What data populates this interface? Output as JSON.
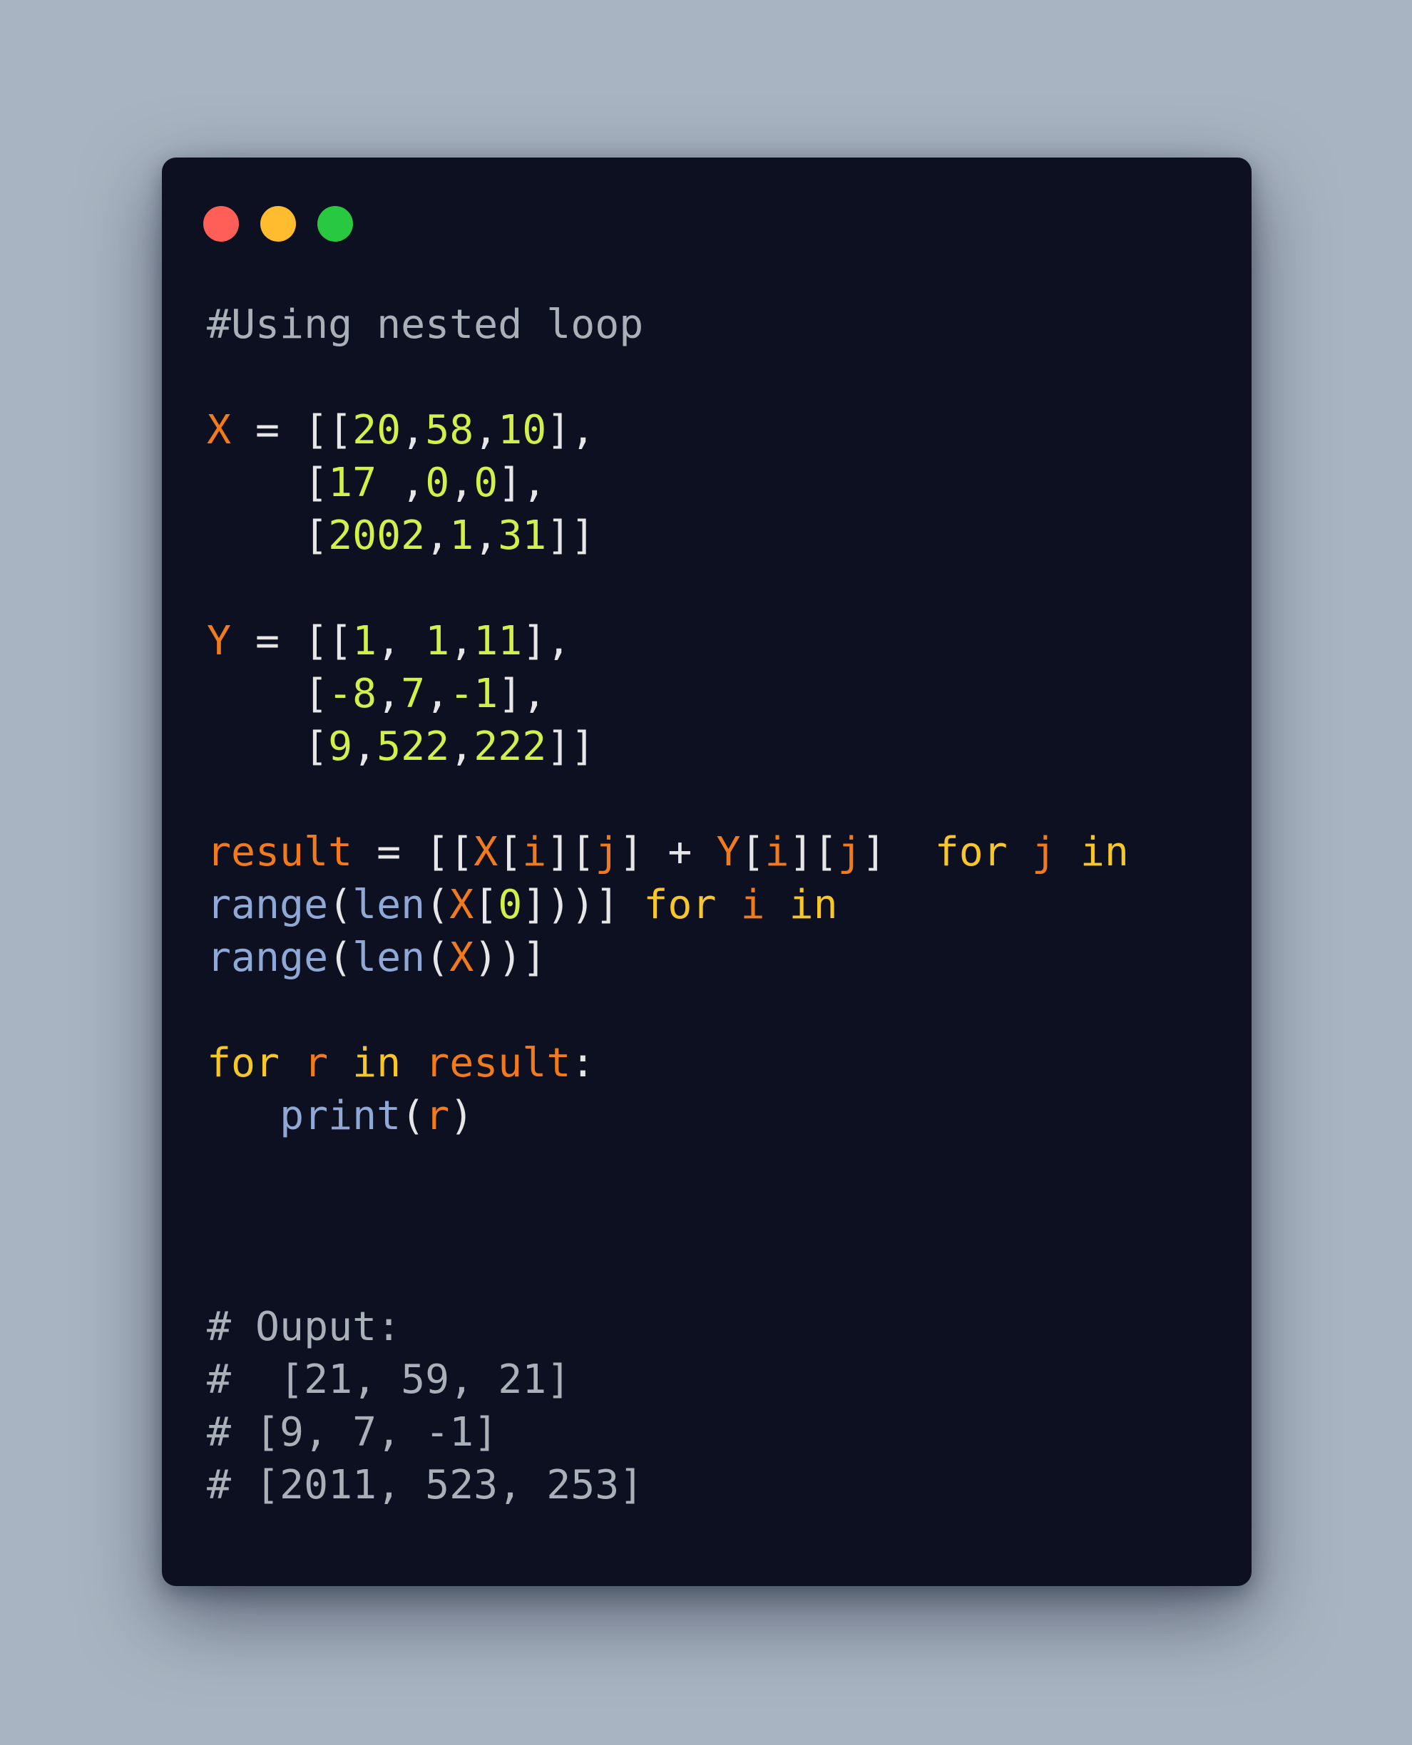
{
  "window": {
    "buttons": {
      "close_color": "#ff5f57",
      "minimize_color": "#febc2e",
      "maximize_color": "#28c840"
    }
  },
  "colors": {
    "background": "#a9b4c2",
    "editor": "#0d1020",
    "comment": "#aab0b8",
    "variable": "#f17a1c",
    "number": "#d2f04a",
    "keyword": "#f7c72a",
    "builtin": "#8fa8d6",
    "punctuation": "#e6e6e6"
  },
  "code": {
    "lines": [
      {
        "gap": 0,
        "tokens": [
          {
            "t": "#Using nested loop",
            "k": "comment"
          }
        ]
      },
      {
        "gap": 1,
        "tokens": [
          {
            "t": "X",
            "k": "var"
          },
          {
            "t": " = [[",
            "k": "punc"
          },
          {
            "t": "20",
            "k": "num"
          },
          {
            "t": ",",
            "k": "punc"
          },
          {
            "t": "58",
            "k": "num"
          },
          {
            "t": ",",
            "k": "punc"
          },
          {
            "t": "10",
            "k": "num"
          },
          {
            "t": "],",
            "k": "punc"
          }
        ]
      },
      {
        "gap": 0,
        "tokens": [
          {
            "t": "    [",
            "k": "punc"
          },
          {
            "t": "17",
            "k": "num"
          },
          {
            "t": " ,",
            "k": "punc"
          },
          {
            "t": "0",
            "k": "num"
          },
          {
            "t": ",",
            "k": "punc"
          },
          {
            "t": "0",
            "k": "num"
          },
          {
            "t": "],",
            "k": "punc"
          }
        ]
      },
      {
        "gap": 0,
        "tokens": [
          {
            "t": "    [",
            "k": "punc"
          },
          {
            "t": "2002",
            "k": "num"
          },
          {
            "t": ",",
            "k": "punc"
          },
          {
            "t": "1",
            "k": "num"
          },
          {
            "t": ",",
            "k": "punc"
          },
          {
            "t": "31",
            "k": "num"
          },
          {
            "t": "]]",
            "k": "punc"
          }
        ]
      },
      {
        "gap": 1,
        "tokens": [
          {
            "t": "Y",
            "k": "var"
          },
          {
            "t": " = [[",
            "k": "punc"
          },
          {
            "t": "1",
            "k": "num"
          },
          {
            "t": ", ",
            "k": "punc"
          },
          {
            "t": "1",
            "k": "num"
          },
          {
            "t": ",",
            "k": "punc"
          },
          {
            "t": "11",
            "k": "num"
          },
          {
            "t": "],",
            "k": "punc"
          }
        ]
      },
      {
        "gap": 0,
        "tokens": [
          {
            "t": "    [",
            "k": "punc"
          },
          {
            "t": "-8",
            "k": "num"
          },
          {
            "t": ",",
            "k": "punc"
          },
          {
            "t": "7",
            "k": "num"
          },
          {
            "t": ",",
            "k": "punc"
          },
          {
            "t": "-1",
            "k": "num"
          },
          {
            "t": "],",
            "k": "punc"
          }
        ]
      },
      {
        "gap": 0,
        "tokens": [
          {
            "t": "    [",
            "k": "punc"
          },
          {
            "t": "9",
            "k": "num"
          },
          {
            "t": ",",
            "k": "punc"
          },
          {
            "t": "522",
            "k": "num"
          },
          {
            "t": ",",
            "k": "punc"
          },
          {
            "t": "222",
            "k": "num"
          },
          {
            "t": "]]",
            "k": "punc"
          }
        ]
      },
      {
        "gap": 1,
        "tokens": [
          {
            "t": "result",
            "k": "var"
          },
          {
            "t": " = [[",
            "k": "punc"
          },
          {
            "t": "X",
            "k": "var"
          },
          {
            "t": "[",
            "k": "punc"
          },
          {
            "t": "i",
            "k": "var"
          },
          {
            "t": "][",
            "k": "punc"
          },
          {
            "t": "j",
            "k": "var"
          },
          {
            "t": "] + ",
            "k": "punc"
          },
          {
            "t": "Y",
            "k": "var"
          },
          {
            "t": "[",
            "k": "punc"
          },
          {
            "t": "i",
            "k": "var"
          },
          {
            "t": "][",
            "k": "punc"
          },
          {
            "t": "j",
            "k": "var"
          },
          {
            "t": "]  ",
            "k": "punc"
          },
          {
            "t": "for",
            "k": "kw"
          },
          {
            "t": " ",
            "k": "punc"
          },
          {
            "t": "j",
            "k": "var"
          },
          {
            "t": " ",
            "k": "punc"
          },
          {
            "t": "in",
            "k": "kw"
          }
        ]
      },
      {
        "gap": 0,
        "tokens": [
          {
            "t": "range",
            "k": "builtin"
          },
          {
            "t": "(",
            "k": "punc"
          },
          {
            "t": "len",
            "k": "builtin"
          },
          {
            "t": "(",
            "k": "punc"
          },
          {
            "t": "X",
            "k": "var"
          },
          {
            "t": "[",
            "k": "punc"
          },
          {
            "t": "0",
            "k": "num"
          },
          {
            "t": "]))] ",
            "k": "punc"
          },
          {
            "t": "for",
            "k": "kw"
          },
          {
            "t": " ",
            "k": "punc"
          },
          {
            "t": "i",
            "k": "var"
          },
          {
            "t": " ",
            "k": "punc"
          },
          {
            "t": "in",
            "k": "kw"
          }
        ]
      },
      {
        "gap": 0,
        "tokens": [
          {
            "t": "range",
            "k": "builtin"
          },
          {
            "t": "(",
            "k": "punc"
          },
          {
            "t": "len",
            "k": "builtin"
          },
          {
            "t": "(",
            "k": "punc"
          },
          {
            "t": "X",
            "k": "var"
          },
          {
            "t": "))]",
            "k": "punc"
          }
        ]
      },
      {
        "gap": 1,
        "tokens": [
          {
            "t": "for",
            "k": "kw"
          },
          {
            "t": " ",
            "k": "punc"
          },
          {
            "t": "r",
            "k": "var"
          },
          {
            "t": " ",
            "k": "punc"
          },
          {
            "t": "in",
            "k": "kw"
          },
          {
            "t": " ",
            "k": "punc"
          },
          {
            "t": "result",
            "k": "var"
          },
          {
            "t": ":",
            "k": "punc"
          }
        ]
      },
      {
        "gap": 0,
        "tokens": [
          {
            "t": "   ",
            "k": "punc"
          },
          {
            "t": "print",
            "k": "builtin"
          },
          {
            "t": "(",
            "k": "punc"
          },
          {
            "t": "r",
            "k": "var"
          },
          {
            "t": ")",
            "k": "punc"
          }
        ]
      },
      {
        "gap": 3,
        "tokens": [
          {
            "t": "# Ouput:",
            "k": "comment"
          }
        ]
      },
      {
        "gap": 0,
        "tokens": [
          {
            "t": "#  [21, 59, 21]",
            "k": "comment"
          }
        ]
      },
      {
        "gap": 0,
        "tokens": [
          {
            "t": "# [9, 7, -1]",
            "k": "comment"
          }
        ]
      },
      {
        "gap": 0,
        "tokens": [
          {
            "t": "# [2011, 523, 253]",
            "k": "comment"
          }
        ]
      }
    ]
  }
}
